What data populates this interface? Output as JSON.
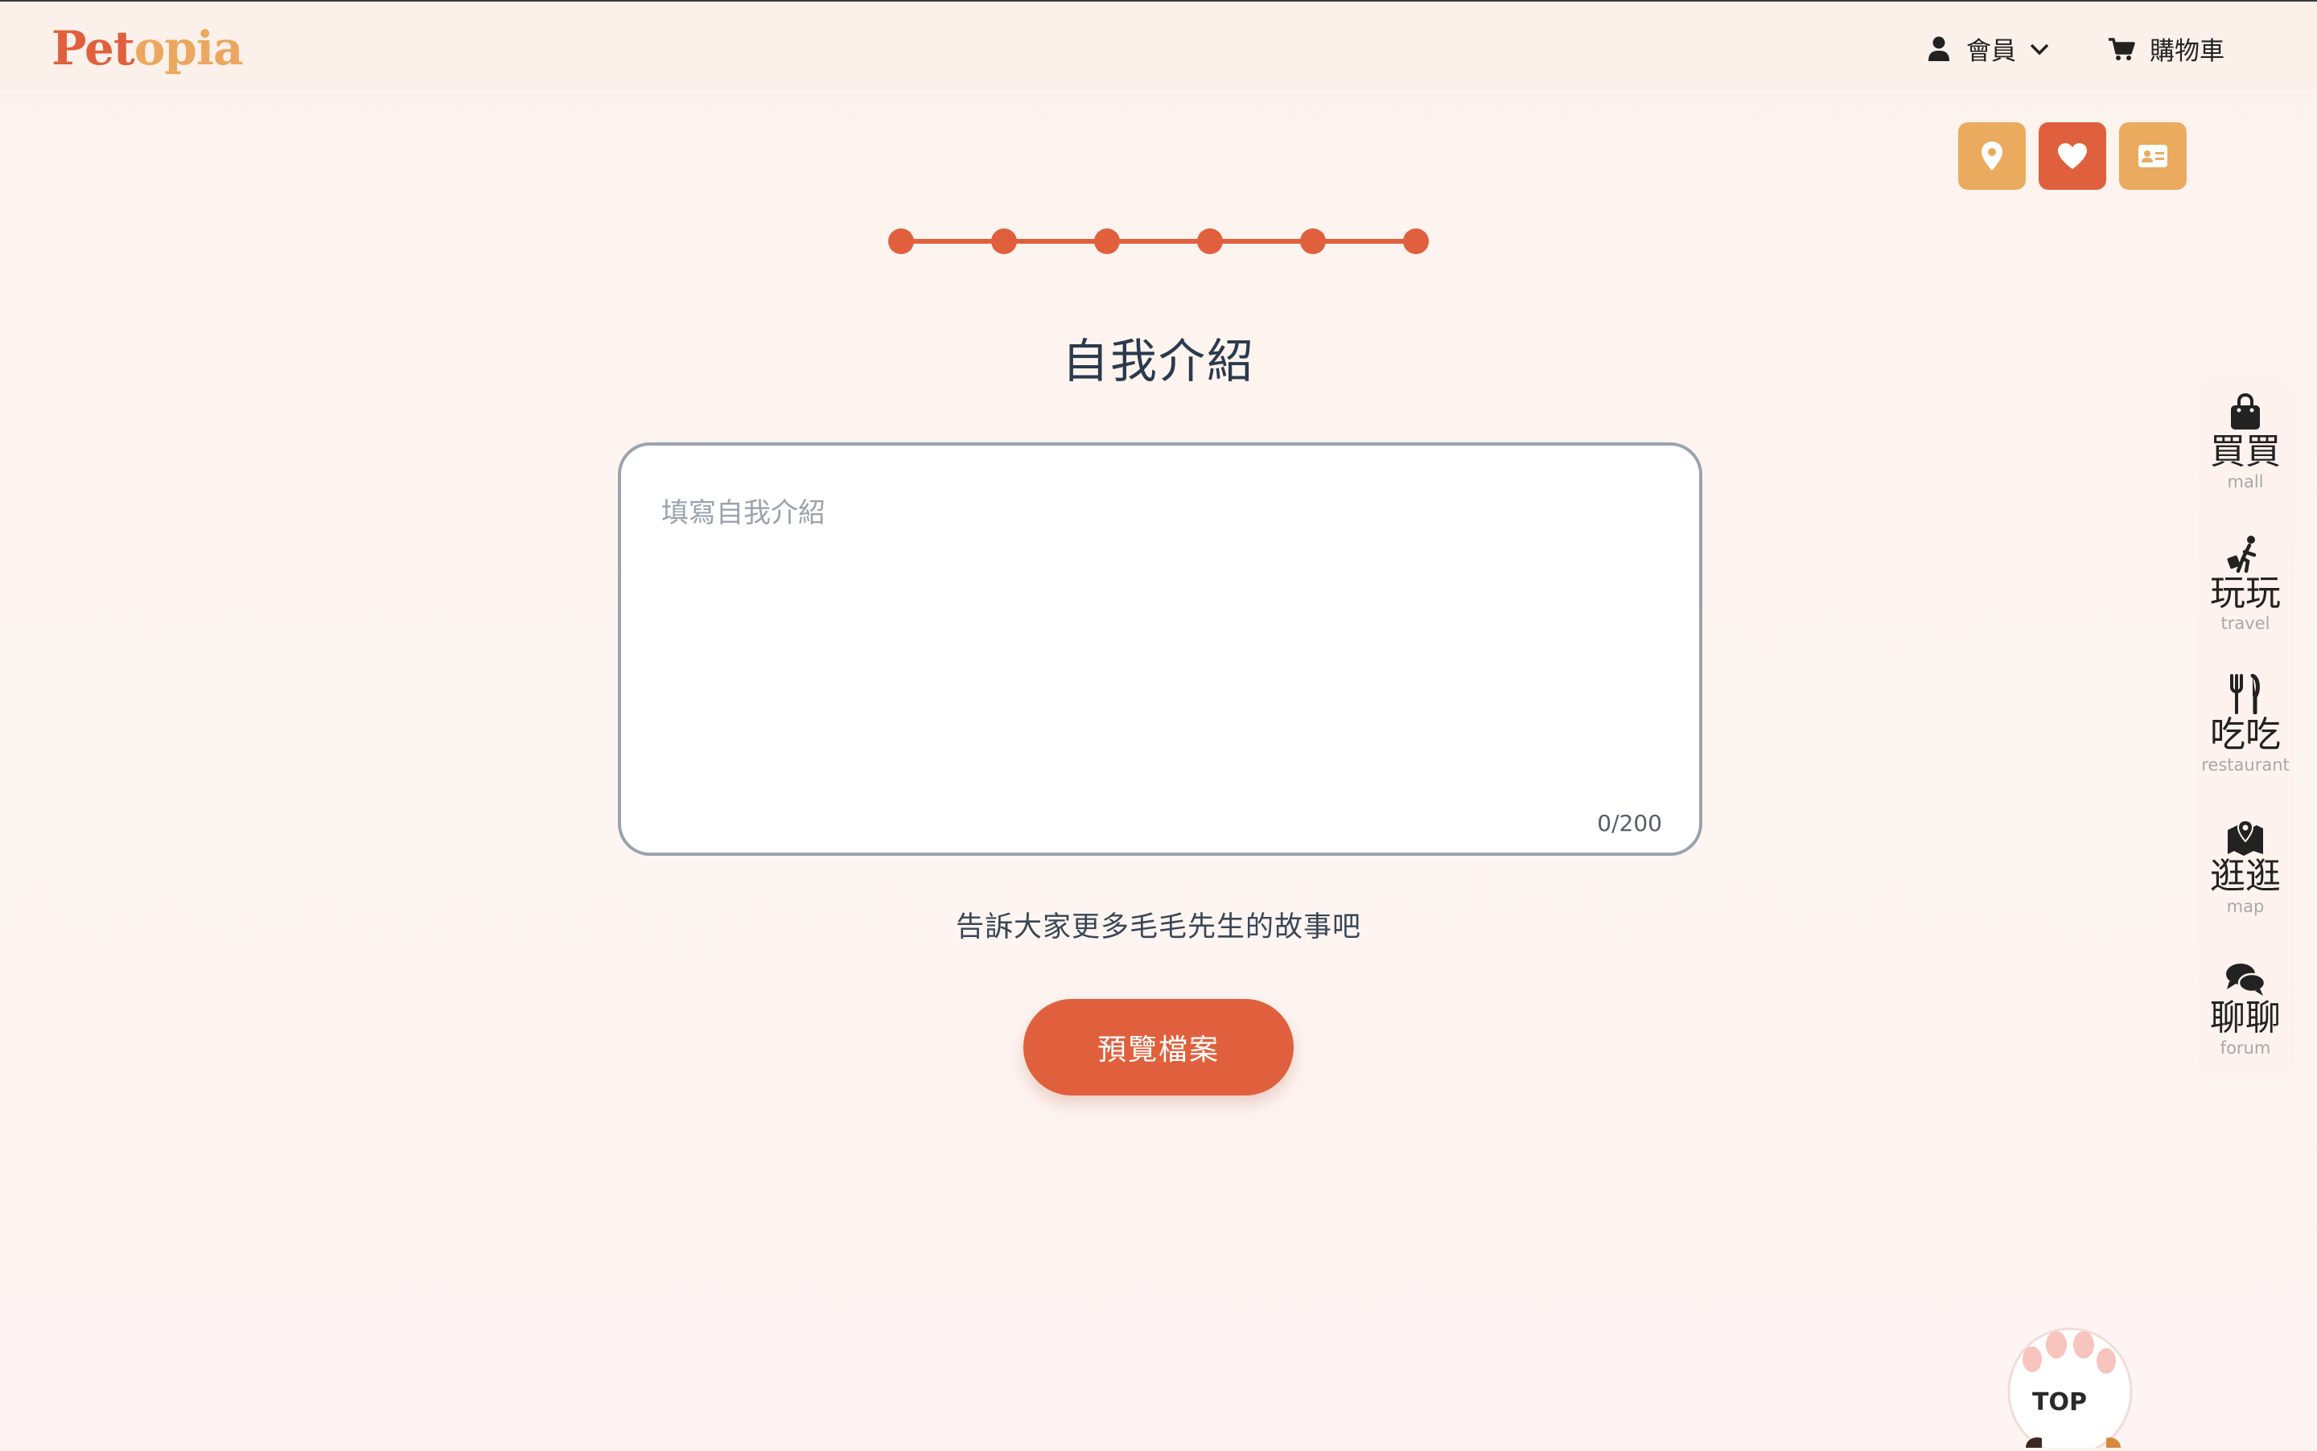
{
  "header": {
    "logo_part1": "Pet",
    "logo_part2": "opia",
    "member_label": "會員",
    "cart_label": "購物車"
  },
  "quick_buttons": [
    {
      "name": "location",
      "icon": "location-pin-icon",
      "color": "#ebab5f"
    },
    {
      "name": "favorites",
      "icon": "heart-icon",
      "color": "#e0603e"
    },
    {
      "name": "profile-card",
      "icon": "id-card-icon",
      "color": "#ebab5f"
    }
  ],
  "progress": {
    "total_steps": 6,
    "current_step": 6
  },
  "form": {
    "title": "自我介紹",
    "textarea_placeholder": "填寫自我介紹",
    "counter": "0/200",
    "hint": "告訴大家更多毛毛先生的故事吧",
    "preview_button": "預覽檔案"
  },
  "sidenav": [
    {
      "zh": "買買",
      "en": "mall",
      "icon": "shopping-bag-icon"
    },
    {
      "zh": "玩玩",
      "en": "travel",
      "icon": "person-walking-luggage-icon"
    },
    {
      "zh": "吃吃",
      "en": "restaurant",
      "icon": "utensils-icon"
    },
    {
      "zh": "逛逛",
      "en": "map",
      "icon": "map-location-icon"
    },
    {
      "zh": "聊聊",
      "en": "forum",
      "icon": "comments-icon"
    }
  ],
  "top_button": {
    "label": "TOP"
  },
  "colors": {
    "primary": "#e0603e",
    "secondary": "#ebab5f",
    "background": "#fdf3ee"
  }
}
